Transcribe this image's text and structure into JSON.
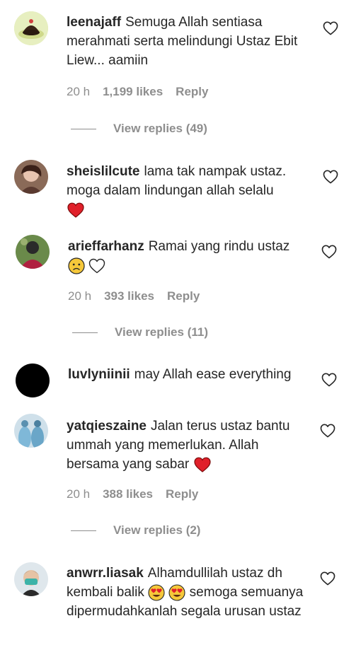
{
  "comments": [
    {
      "username": "leenajaff",
      "text": "Semuga Allah sentiasa merahmati serta melindungi Ustaz Ebit Liew... aamiin",
      "time": "20 h",
      "likes": "1,199 likes",
      "reply": "Reply",
      "view_replies": "View replies (49)"
    },
    {
      "username": "sheislilcute",
      "text": "lama tak nampak ustaz. moga dalam lindungan allah selalu"
    },
    {
      "username": "arieffarhanz",
      "text": "Ramai yang rindu ustaz",
      "time": "20 h",
      "likes": "393 likes",
      "reply": "Reply",
      "view_replies": "View replies (11)"
    },
    {
      "username": "luvlyniinii",
      "text": "may Allah ease everything"
    },
    {
      "username": "yatqieszaine",
      "text": "Jalan terus ustaz bantu ummah yang memerlukan. Allah bersama yang sabar",
      "time": "20 h",
      "likes": "388 likes",
      "reply": "Reply",
      "view_replies": "View replies (2)"
    },
    {
      "username": "anwrr.liasak",
      "text_before": "Alhamdullilah ustaz dh kembali balik",
      "text_after": "semoga semuanya dipermudahkanlah segala urusan ustaz"
    }
  ],
  "colors": {
    "text": "#262626",
    "secondary": "#8e8e8e",
    "heart_red": "#ed4956"
  },
  "icons": [
    "heart-outline-icon",
    "red-heart-emoji",
    "frowning-face-emoji",
    "heart-eyes-emoji"
  ]
}
